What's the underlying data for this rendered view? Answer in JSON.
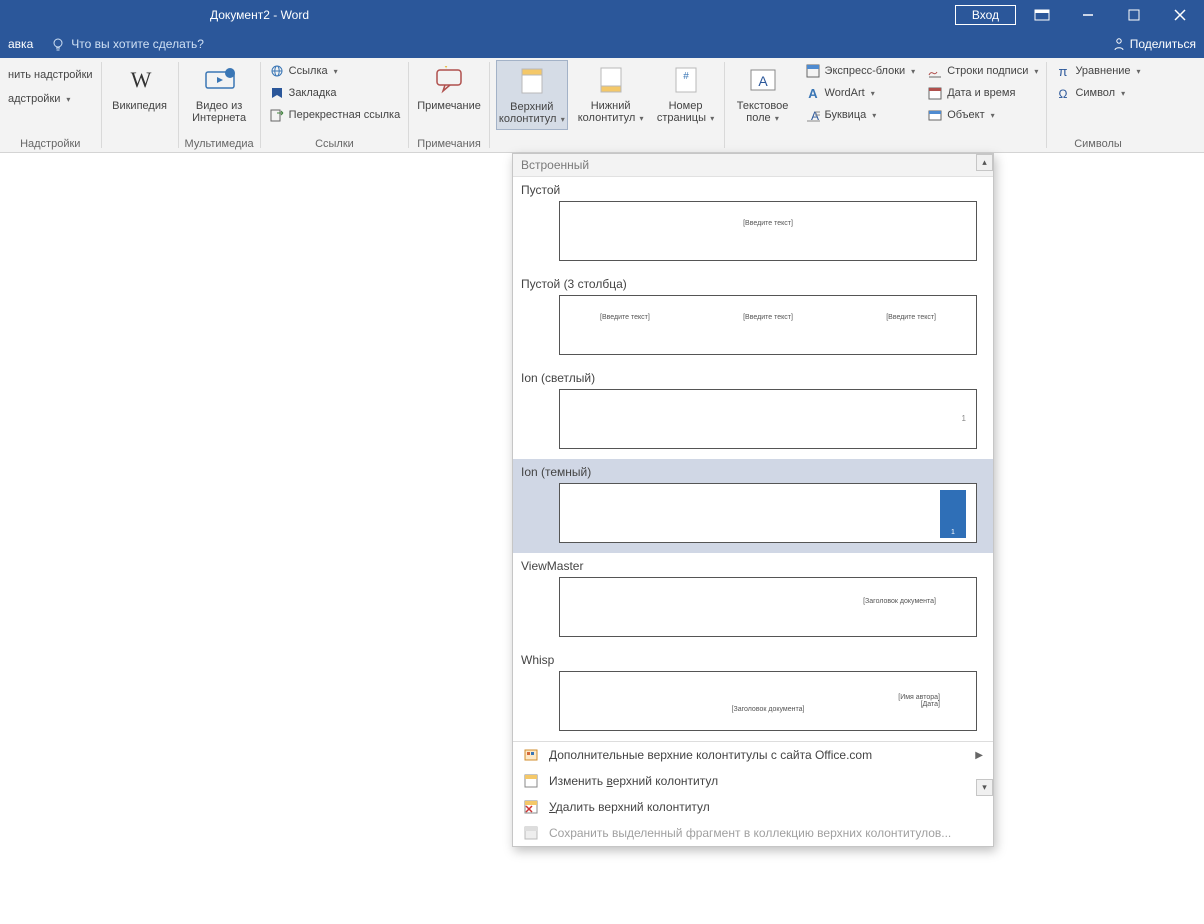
{
  "titlebar": {
    "title": "Документ2 - Word",
    "signin": "Вход"
  },
  "tabbar": {
    "tab_help": "авка",
    "tell_me": "Что вы хотите сделать?",
    "share": "Поделиться"
  },
  "ribbon": {
    "addins": {
      "get": "нить надстройки",
      "my": "адстройки",
      "group": "Надстройки"
    },
    "wikipedia": "Википедия",
    "video": {
      "line1": "Видео из",
      "line2": "Интернета",
      "group": "Мультимедиа"
    },
    "links": {
      "link": "Ссылка",
      "bookmark": "Закладка",
      "cross": "Перекрестная ссылка",
      "group": "Ссылки"
    },
    "comment": {
      "label": "Примечание",
      "group": "Примечания"
    },
    "header": {
      "line1": "Верхний",
      "line2": "колонтитул"
    },
    "footer": {
      "line1": "Нижний",
      "line2": "колонтитул"
    },
    "pagenum": {
      "line1": "Номер",
      "line2": "страницы"
    },
    "textbox": {
      "line1": "Текстовое",
      "line2": "поле"
    },
    "text": {
      "quick": "Экспресс-блоки",
      "wordart": "WordArt",
      "dropcap": "Буквица",
      "sig": "Строки подписи",
      "date": "Дата и время",
      "object": "Объект"
    },
    "symbols": {
      "equation": "Уравнение",
      "symbol": "Символ",
      "group": "Символы"
    }
  },
  "gallery": {
    "head": "Встроенный",
    "items": [
      {
        "title": "Пустой",
        "placeholder_center": "[Введите текст]"
      },
      {
        "title": "Пустой (3 столбца)",
        "placeholder": "[Введите текст]"
      },
      {
        "title": "Ion (светлый)",
        "num": "1"
      },
      {
        "title": "Ion (темный)",
        "num": "1"
      },
      {
        "title": "ViewMaster",
        "placeholder": "[Заголовок документа]"
      },
      {
        "title": "Whisp",
        "center": "[Заголовок документа]",
        "right1": "[Имя автора]",
        "right2": "[Дата]"
      }
    ],
    "footer": {
      "more": "Дополнительные верхние колонтитулы с сайта Office.com",
      "edit_pre": "Изменить ",
      "edit_u": "в",
      "edit_post": "ерхний колонтитул",
      "remove_pre": "",
      "remove_u": "У",
      "remove_post": "далить верхний колонтитул",
      "save": "Сохранить выделенный фрагмент в коллекцию верхних колонтитулов..."
    }
  }
}
